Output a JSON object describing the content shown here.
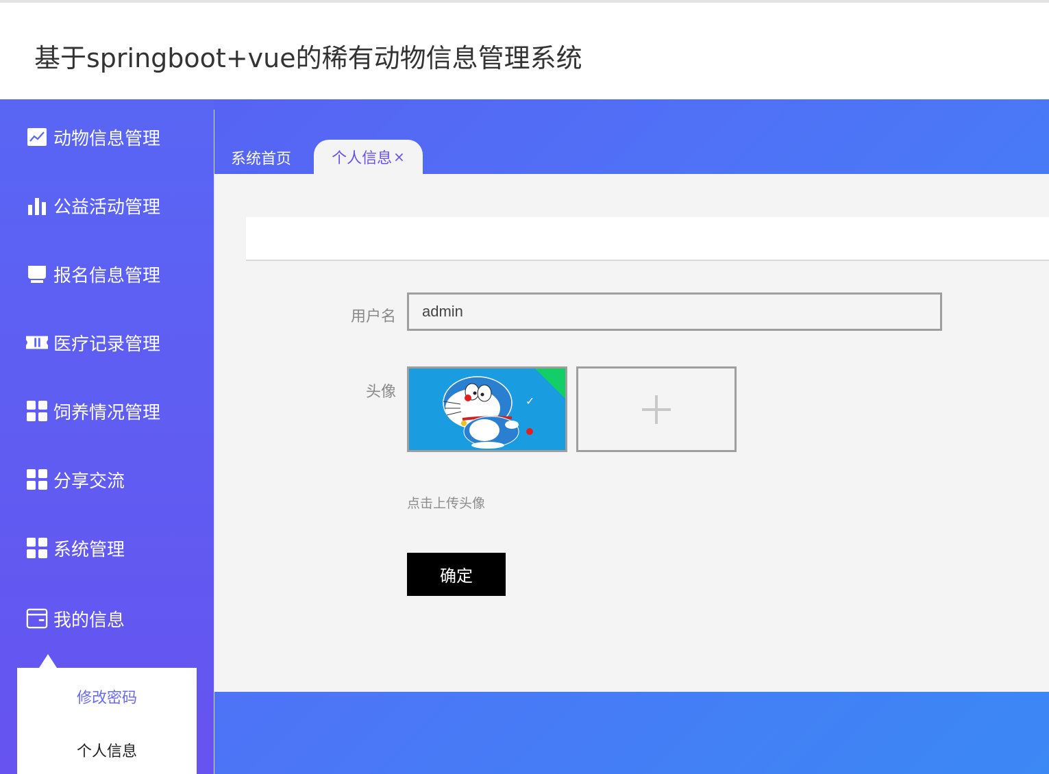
{
  "header": {
    "title": "基于springboot+vue的稀有动物信息管理系统"
  },
  "sidebar": {
    "items": [
      {
        "label": "动物信息管理",
        "icon": "trend-chart-icon"
      },
      {
        "label": "公益活动管理",
        "icon": "bar-chart-icon"
      },
      {
        "label": "报名信息管理",
        "icon": "shop-icon"
      },
      {
        "label": "医疗记录管理",
        "icon": "ticket-icon"
      },
      {
        "label": "饲养情况管理",
        "icon": "grid-icon"
      },
      {
        "label": "分享交流",
        "icon": "grid-icon"
      },
      {
        "label": "系统管理",
        "icon": "grid-icon"
      },
      {
        "label": "我的信息",
        "icon": "wallet-icon"
      }
    ],
    "submenu": [
      {
        "label": "修改密码",
        "color": "#6a6af0"
      },
      {
        "label": "个人信息",
        "color": "#222222"
      }
    ]
  },
  "tabs": {
    "home": "系统首页",
    "active": "个人信息",
    "close_glyph": "×"
  },
  "form": {
    "username_label": "用户名",
    "username_value": "admin",
    "avatar_label": "头像",
    "upload_tip": "点击上传头像",
    "confirm_label": "确定"
  },
  "colors": {
    "sidebar_gradient_top": "#5966f4",
    "sidebar_gradient_bottom": "#6653f0",
    "frame_gradient_end": "#3b88f5",
    "active_tab_text": "#6a50e8",
    "upload_success": "#13ce66",
    "confirm_button": "#000000"
  }
}
